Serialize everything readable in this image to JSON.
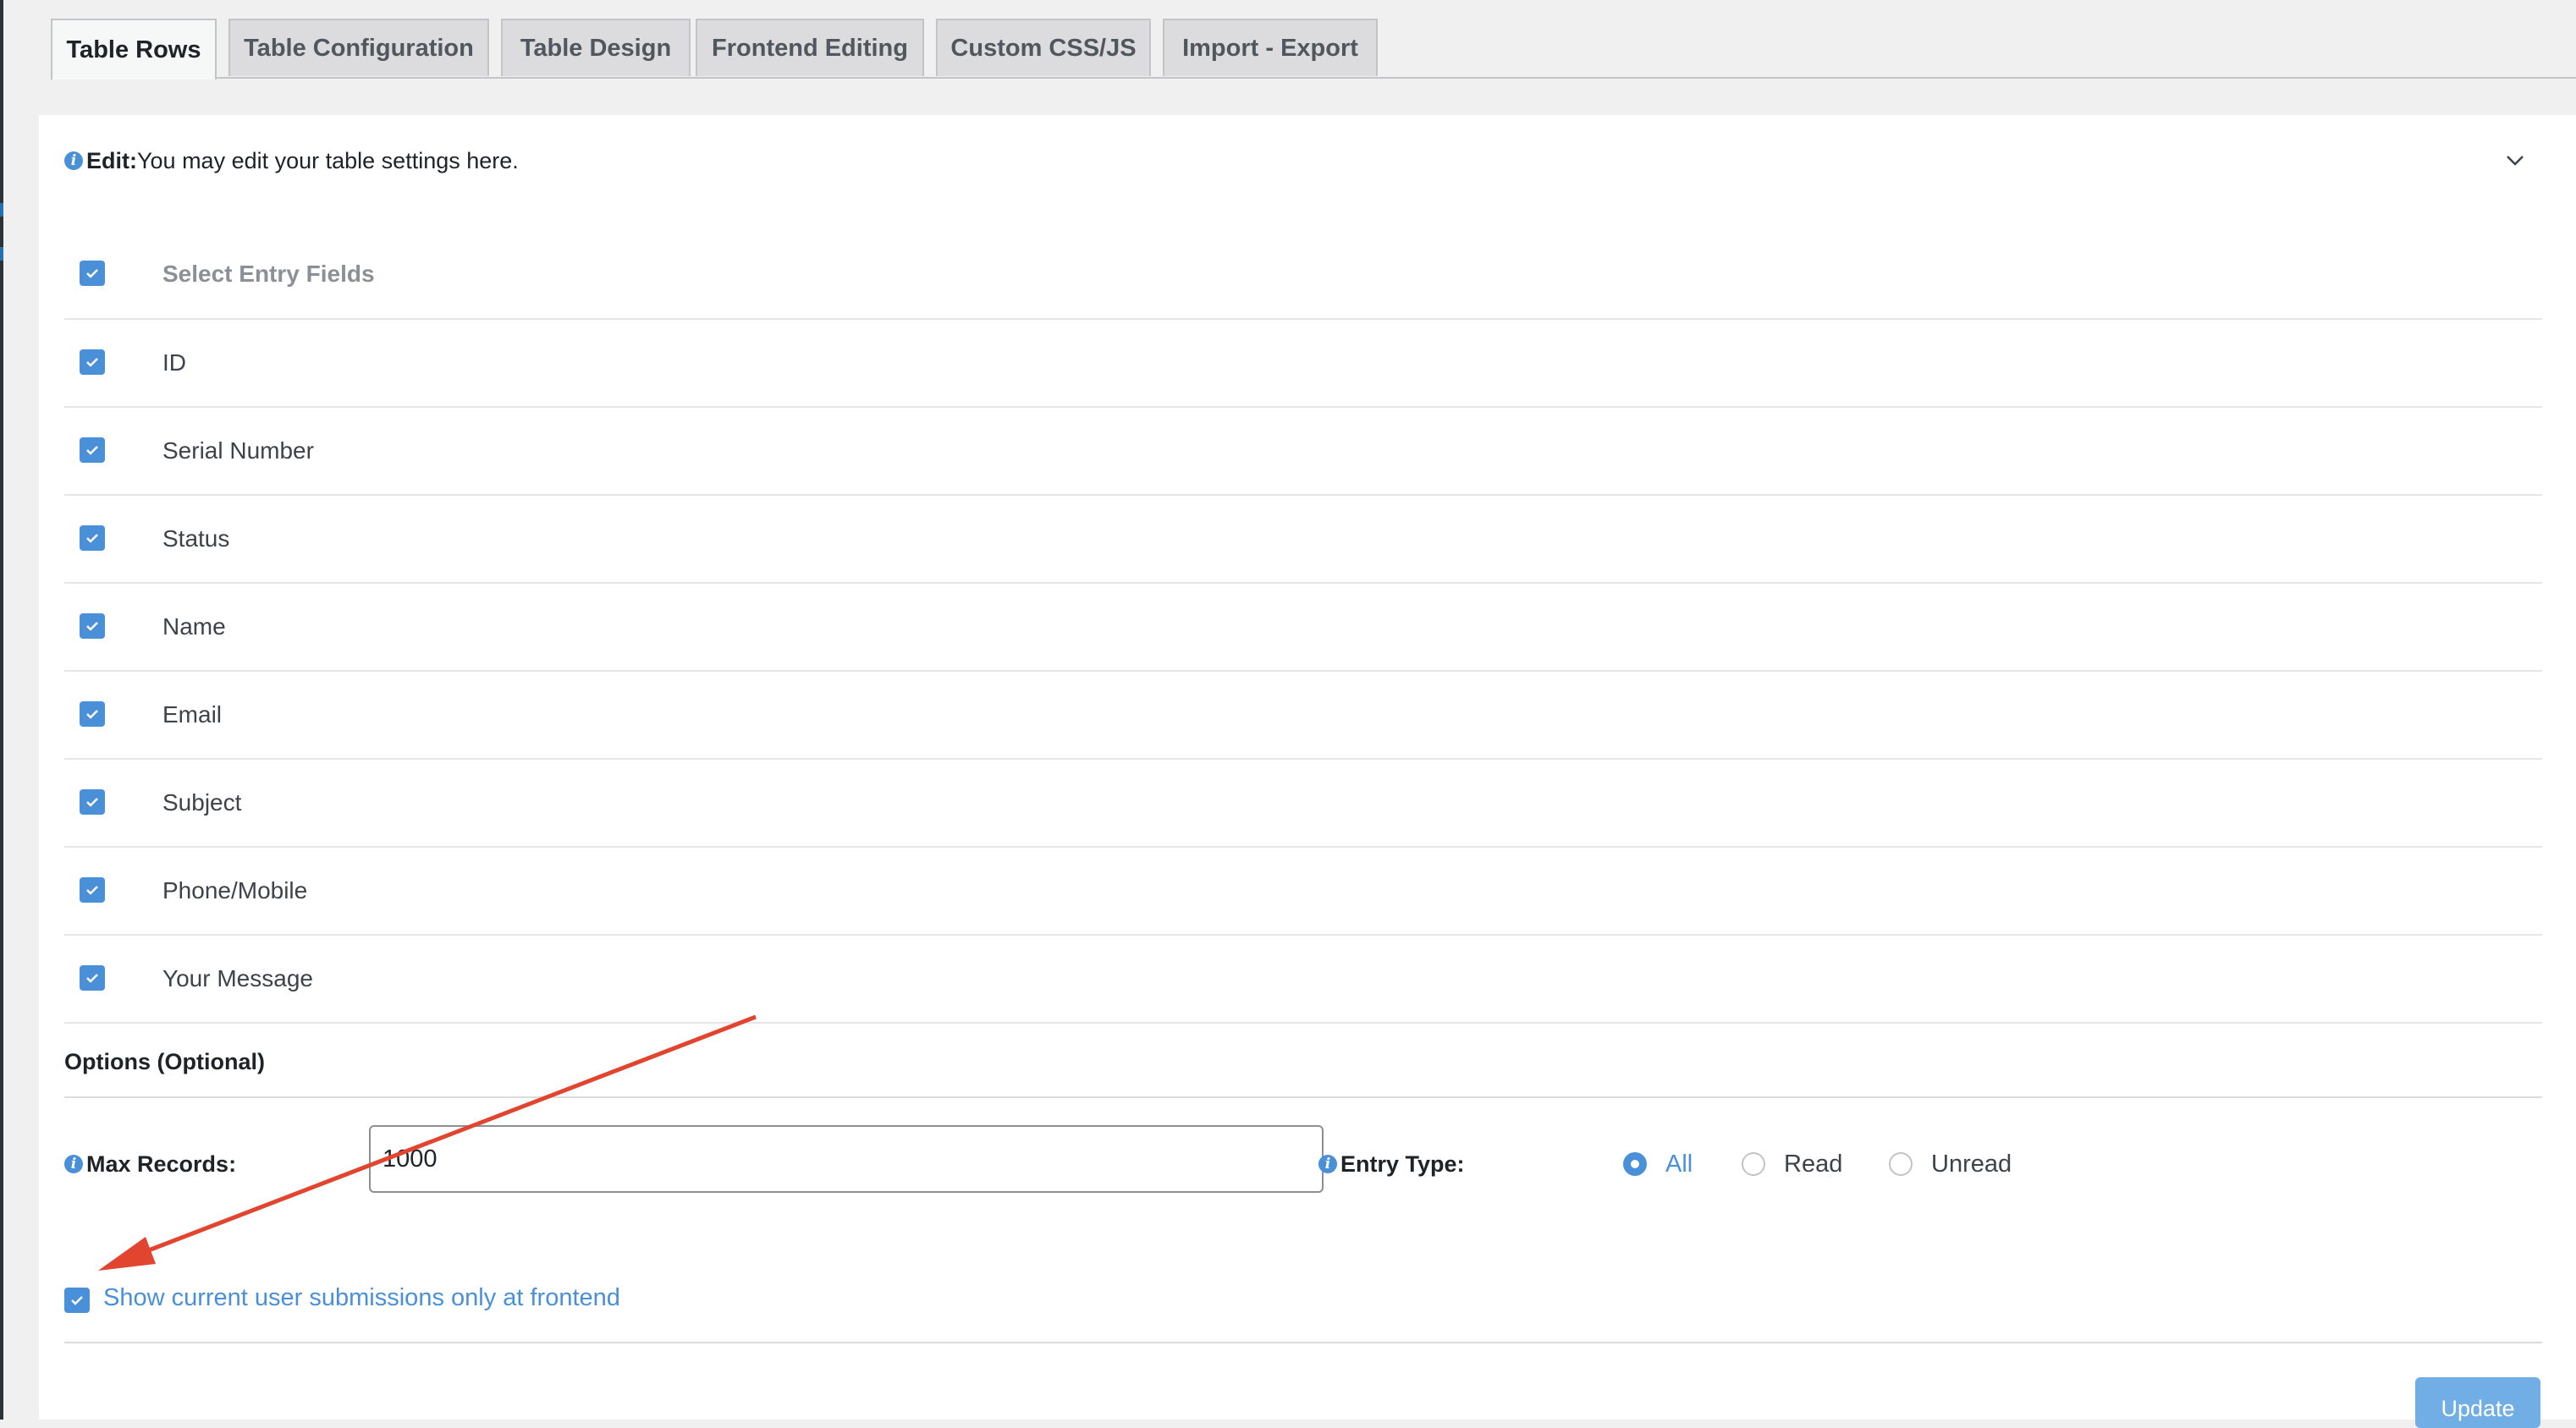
{
  "tabs": [
    {
      "label": "Table Rows",
      "active": true
    },
    {
      "label": "Table Configuration",
      "active": false
    },
    {
      "label": "Table Design",
      "active": false
    },
    {
      "label": "Frontend Editing",
      "active": false
    },
    {
      "label": "Custom CSS/JS",
      "active": false
    },
    {
      "label": "Import - Export",
      "active": false
    }
  ],
  "notice": {
    "label": "Edit:",
    "text": "You may edit your table settings here."
  },
  "fields": {
    "header": {
      "label": "Select Entry Fields",
      "checked": true
    },
    "items": [
      {
        "label": "ID",
        "checked": true
      },
      {
        "label": "Serial Number",
        "checked": true
      },
      {
        "label": "Status",
        "checked": true
      },
      {
        "label": "Name",
        "checked": true
      },
      {
        "label": "Email",
        "checked": true
      },
      {
        "label": "Subject",
        "checked": true
      },
      {
        "label": "Phone/Mobile",
        "checked": true
      },
      {
        "label": "Your Message",
        "checked": true
      }
    ]
  },
  "options": {
    "title": "Options (Optional)",
    "max_records": {
      "label": "Max Records:",
      "value": "1000"
    },
    "entry_type": {
      "label": "Entry Type:",
      "options": [
        {
          "label": "All",
          "selected": true
        },
        {
          "label": "Read",
          "selected": false
        },
        {
          "label": "Unread",
          "selected": false
        }
      ]
    },
    "show_current_user": {
      "label": "Show current user submissions only at frontend",
      "checked": true
    }
  },
  "update_button": {
    "label": "Update"
  },
  "colors": {
    "accent": "#4a90d9",
    "annotation_arrow": "#e2452f",
    "update_button": "#72aee6"
  },
  "icons": {
    "info": "info-icon",
    "collapse": "chevron-down-icon",
    "check": "checkmark-icon"
  }
}
